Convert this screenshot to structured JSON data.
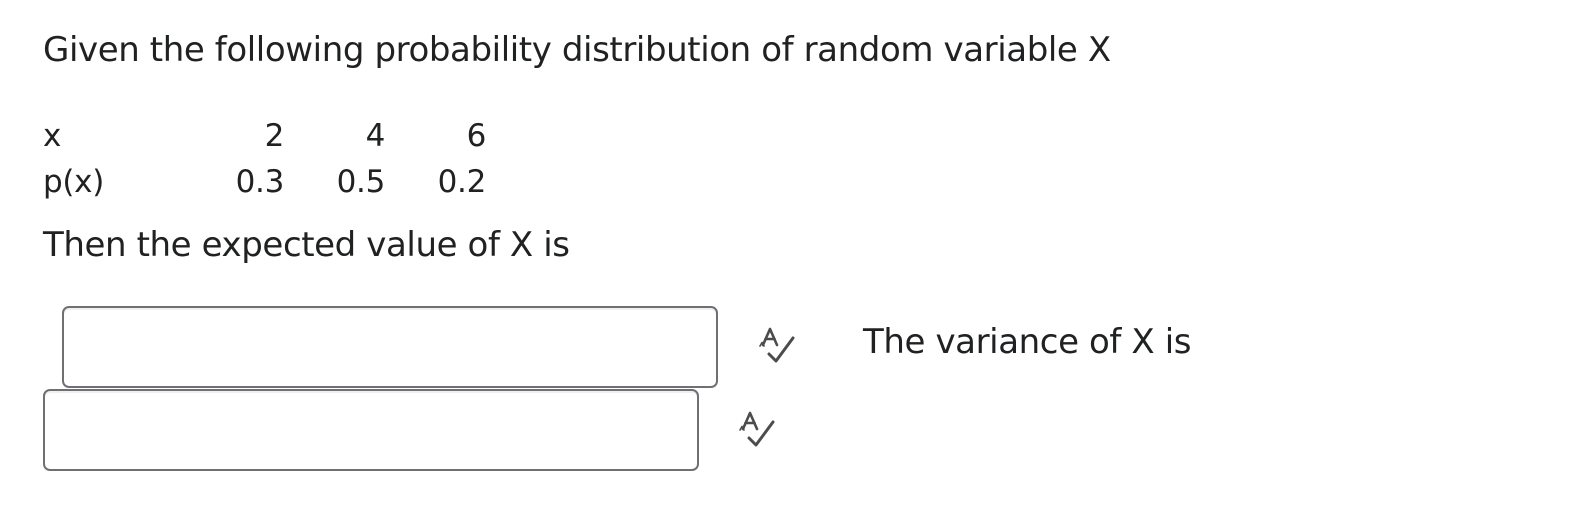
{
  "question": {
    "prompt": "Given the following probability distribution of random variable X",
    "table": {
      "rows": [
        {
          "label": "x",
          "values": [
            "2",
            "4",
            "6"
          ]
        },
        {
          "label": "p(x)",
          "values": [
            "0.3",
            "0.5",
            "0.2"
          ]
        }
      ]
    },
    "expected_value_prompt": "Then the expected value of X is",
    "variance_prompt": "The variance of X is"
  },
  "answers": [
    {
      "value": "",
      "placeholder": "",
      "icon": "spell-check-icon"
    },
    {
      "value": "",
      "placeholder": "",
      "icon": "spell-check-icon"
    }
  ]
}
